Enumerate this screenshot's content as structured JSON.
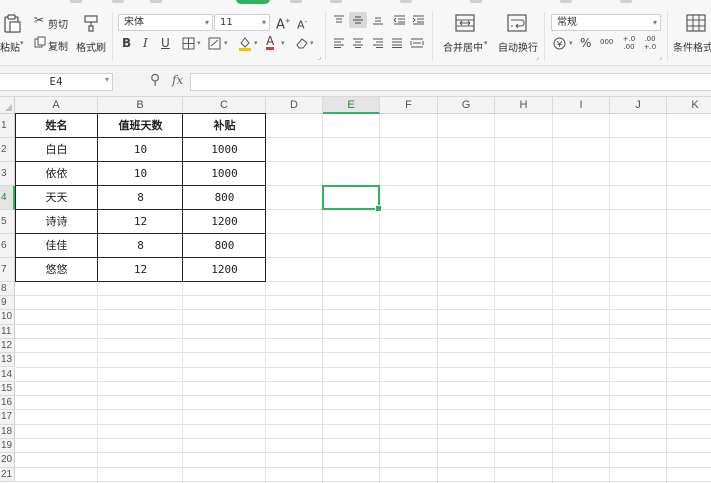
{
  "ribbon": {
    "paste_label": "粘贴",
    "cut_label": "剪切",
    "copy_label": "复制",
    "format_painter_label": "格式刷",
    "font_name": "宋体",
    "font_size": "11",
    "bold_label": "B",
    "italic_label": "I",
    "underline_label": "U",
    "merge_center_label": "合并居中",
    "wrap_text_label": "自动换行",
    "number_format": "常规",
    "percent_label": "%",
    "thousands_label": "000",
    "increase_decimal_label": "+.0 .00",
    "decrease_decimal_label": ".00 +.0",
    "conditional_format_label": "条件格式",
    "accent_color": "#2db35d"
  },
  "formula_bar": {
    "name_box": "E4",
    "fx_label": "fx",
    "formula_value": ""
  },
  "grid": {
    "columns": [
      "A",
      "B",
      "C",
      "D",
      "E",
      "F",
      "G",
      "H",
      "I",
      "J",
      "K"
    ],
    "rows": [
      "1",
      "2",
      "3",
      "4",
      "5",
      "6",
      "7",
      "8",
      "9",
      "10",
      "11",
      "12",
      "13",
      "14",
      "15",
      "16",
      "17",
      "18",
      "19",
      "20",
      "21"
    ],
    "active_column": "E",
    "active_row": "4"
  },
  "table": {
    "headers": [
      "姓名",
      "值班天数",
      "补贴"
    ],
    "rows": [
      [
        "白白",
        "10",
        "1000"
      ],
      [
        "依依",
        "10",
        "1000"
      ],
      [
        "天天",
        "8",
        "800"
      ],
      [
        "诗诗",
        "12",
        "1200"
      ],
      [
        "佳佳",
        "8",
        "800"
      ],
      [
        "悠悠",
        "12",
        "1200"
      ]
    ]
  }
}
